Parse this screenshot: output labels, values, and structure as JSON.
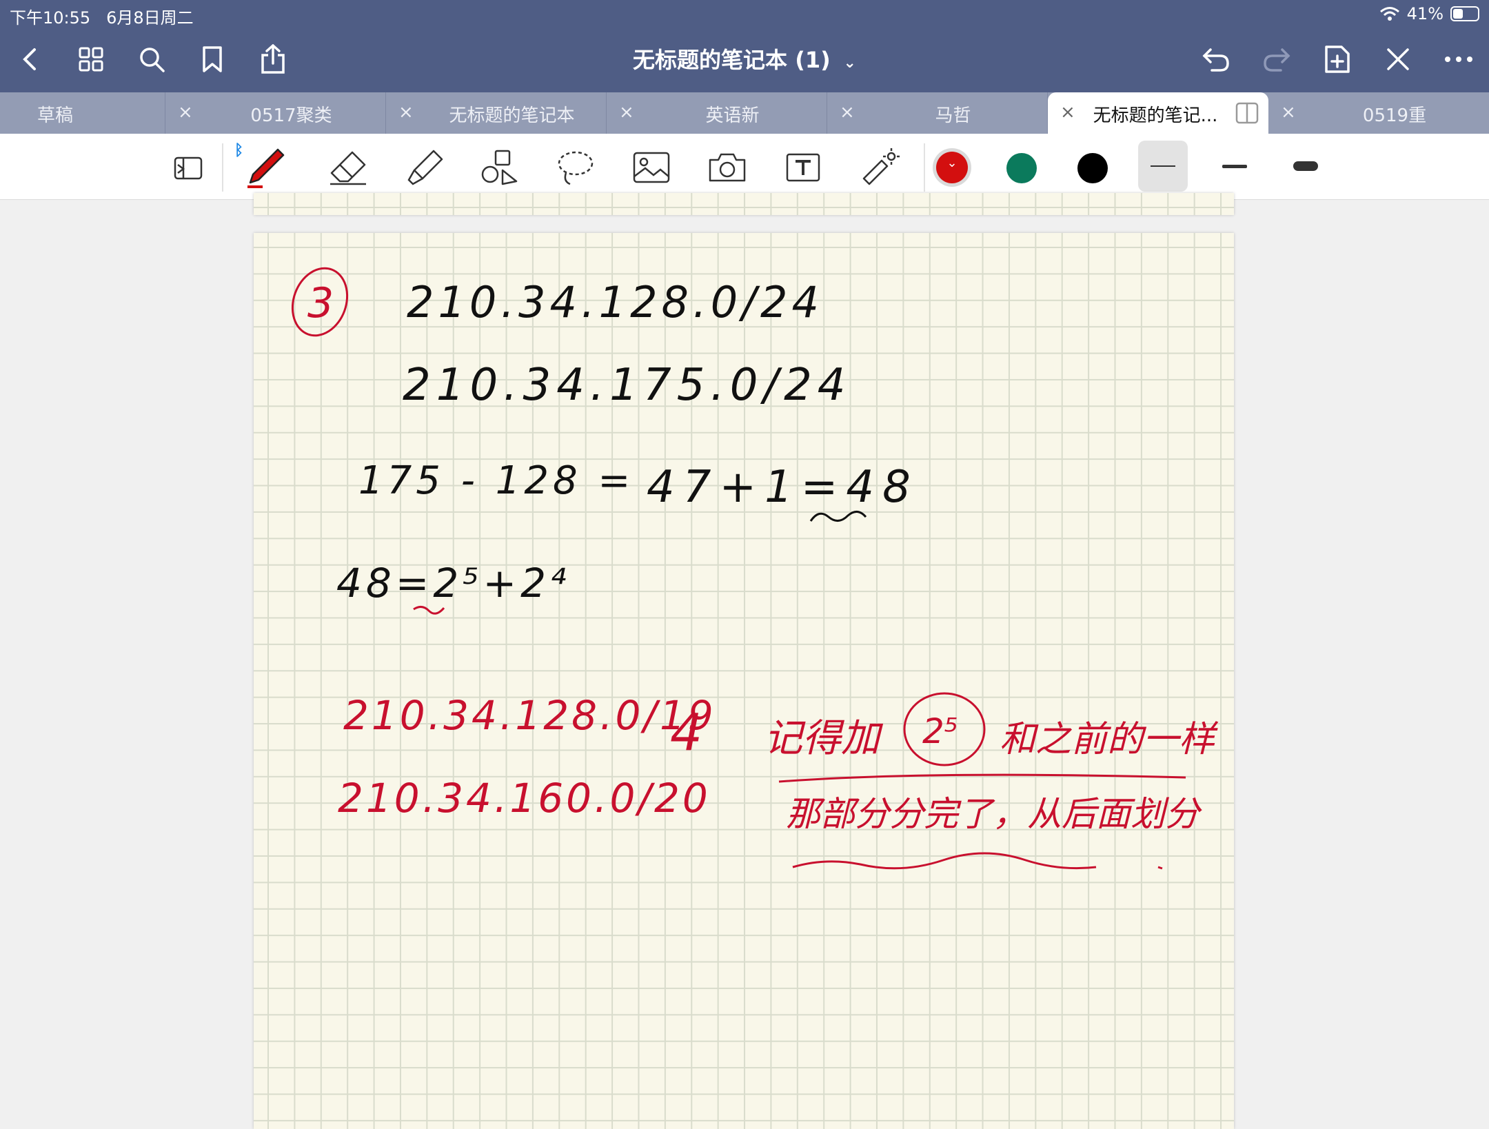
{
  "status_bar": {
    "time": "下午10:55",
    "date": "6月8日周二",
    "battery": "41%",
    "battery_level": 0.41
  },
  "nav": {
    "title": "无标题的笔记本 (1)"
  },
  "tabs": [
    {
      "label": "草稿",
      "close": ""
    },
    {
      "label": "0517聚类",
      "close": "×"
    },
    {
      "label": "无标题的笔记本",
      "close": "×"
    },
    {
      "label": "英语新",
      "close": "×"
    },
    {
      "label": "马哲",
      "close": "×"
    },
    {
      "label": "无标题的笔记...",
      "close": "×"
    },
    {
      "label": "0519重",
      "close": "×"
    }
  ],
  "toolbar": {
    "tools": [
      "readonly-icon",
      "pen-icon",
      "eraser-icon",
      "highlighter-icon",
      "shapes-icon",
      "lasso-icon",
      "image-icon",
      "camera-icon",
      "text-icon",
      "laser-pointer-icon"
    ],
    "colors": [
      "#d30f0f",
      "#0b7a5c",
      "#000000"
    ],
    "selected_color": "#d30f0f",
    "widths": [
      "thin",
      "medium",
      "thick"
    ],
    "selected_width": "thin"
  },
  "handwriting": {
    "problem_number": "3",
    "line1": "210.34.128.0/24",
    "line2": "210.34.175.0/24",
    "line3": "175 - 128 =",
    "line3_result": "47+1=48",
    "line4": "48=2⁵+2⁴",
    "red_line1": "210.34.128.0/19",
    "red_line2": "210.34.160.0/20",
    "note_marker": "4",
    "note_line1a": "记得加",
    "note_line1b": "2⁵",
    "note_line1c": "和之前的一样",
    "note_line2": "那部分分完了，从后面划分"
  }
}
